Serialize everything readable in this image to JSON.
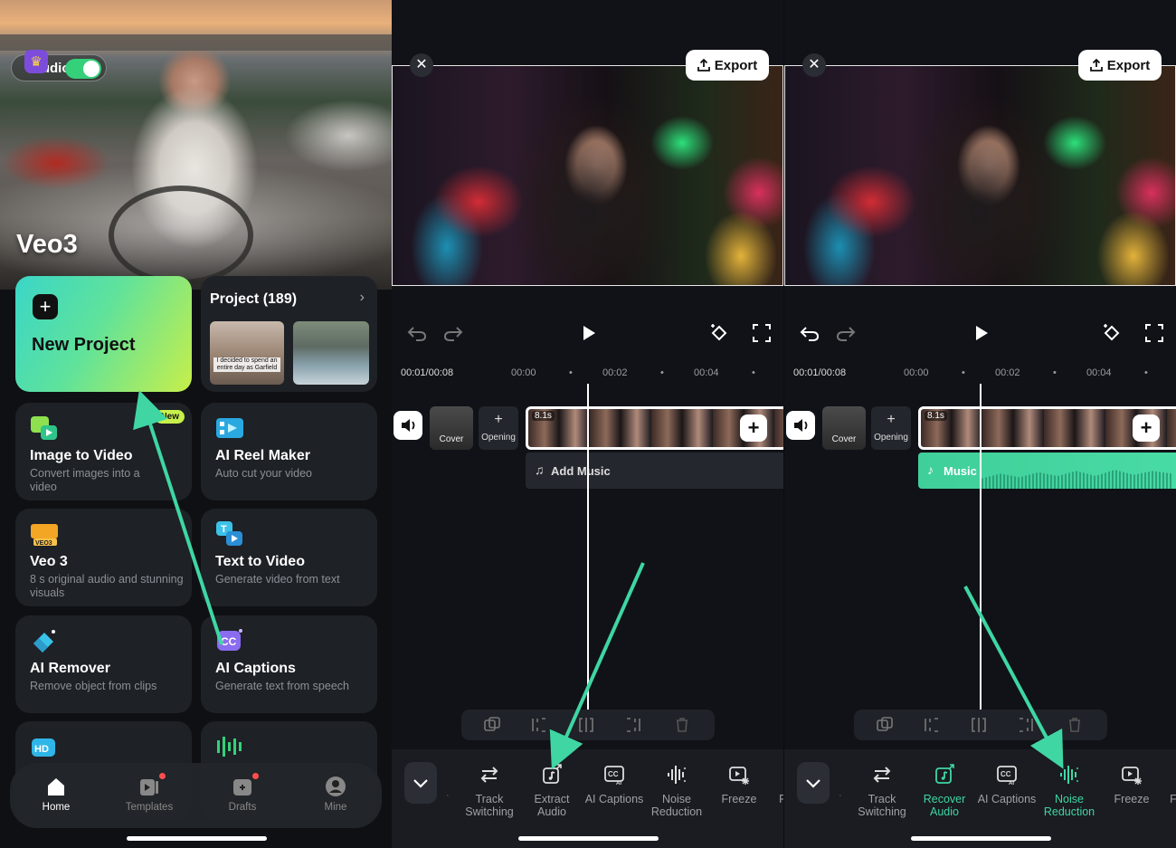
{
  "home": {
    "audio_toggle_label": "Audio",
    "hero_title": "Veo3",
    "new_project": "New Project",
    "project_title": "Project (189)",
    "project_thumb_caption": "I decided to spend an entire day as Garfield",
    "features": [
      {
        "title": "Image to Video",
        "desc": "Convert images into a video",
        "badge": "New",
        "icon": "image-to-video-icon"
      },
      {
        "title": "AI Reel Maker",
        "desc": "Auto cut your video",
        "icon": "reel-maker-icon"
      },
      {
        "title": "Veo 3",
        "desc": "8 s original audio and stunning visuals",
        "icon": "veo3-icon"
      },
      {
        "title": "Text to Video",
        "desc": "Generate video from text",
        "icon": "text-to-video-icon"
      },
      {
        "title": "AI Remover",
        "desc": "Remove object from clips",
        "icon": "eraser-icon"
      },
      {
        "title": "AI Captions",
        "desc": "Generate text from speech",
        "icon": "captions-icon"
      }
    ],
    "tabs": [
      {
        "label": "Home",
        "icon": "home-icon",
        "active": true
      },
      {
        "label": "Templates",
        "icon": "templates-icon"
      },
      {
        "label": "Drafts",
        "icon": "drafts-icon"
      },
      {
        "label": "Mine",
        "icon": "user-icon"
      }
    ]
  },
  "editor_left": {
    "export_label": "Export",
    "time_current": "00:01/00:08",
    "ruler": [
      "00:00",
      "00:02",
      "00:04"
    ],
    "clip_duration": "8.1s",
    "cover_label": "Cover",
    "opening_label": "Opening",
    "music_label": "Add Music",
    "tools": [
      {
        "label": "Track Switching",
        "icon": "track-switch-icon"
      },
      {
        "label": "Extract Audio",
        "icon": "extract-audio-icon"
      },
      {
        "label": "AI Captions",
        "icon": "ai-captions-icon"
      },
      {
        "label": "Noise Reduction",
        "icon": "noise-reduction-icon"
      },
      {
        "label": "Freeze",
        "icon": "freeze-icon"
      },
      {
        "label": "F",
        "icon": ""
      }
    ]
  },
  "editor_right": {
    "export_label": "Export",
    "time_current": "00:01/00:08",
    "ruler": [
      "00:00",
      "00:02",
      "00:04"
    ],
    "clip_duration": "8.1s",
    "cover_label": "Cover",
    "opening_label": "Opening",
    "music_label": "Music",
    "tools": [
      {
        "label": "Track Switching",
        "icon": "track-switch-icon"
      },
      {
        "label": "Recover Audio",
        "icon": "recover-audio-icon",
        "highlight": true
      },
      {
        "label": "AI Captions",
        "icon": "ai-captions-icon"
      },
      {
        "label": "Noise Reduction",
        "icon": "noise-reduction-icon",
        "highlight": true
      },
      {
        "label": "Freeze",
        "icon": "freeze-icon"
      },
      {
        "label": "F",
        "icon": ""
      }
    ]
  },
  "colors": {
    "accent": "#3fd6a3",
    "arrow": "#3fd6a3",
    "new_badge": "#c7f14a"
  }
}
